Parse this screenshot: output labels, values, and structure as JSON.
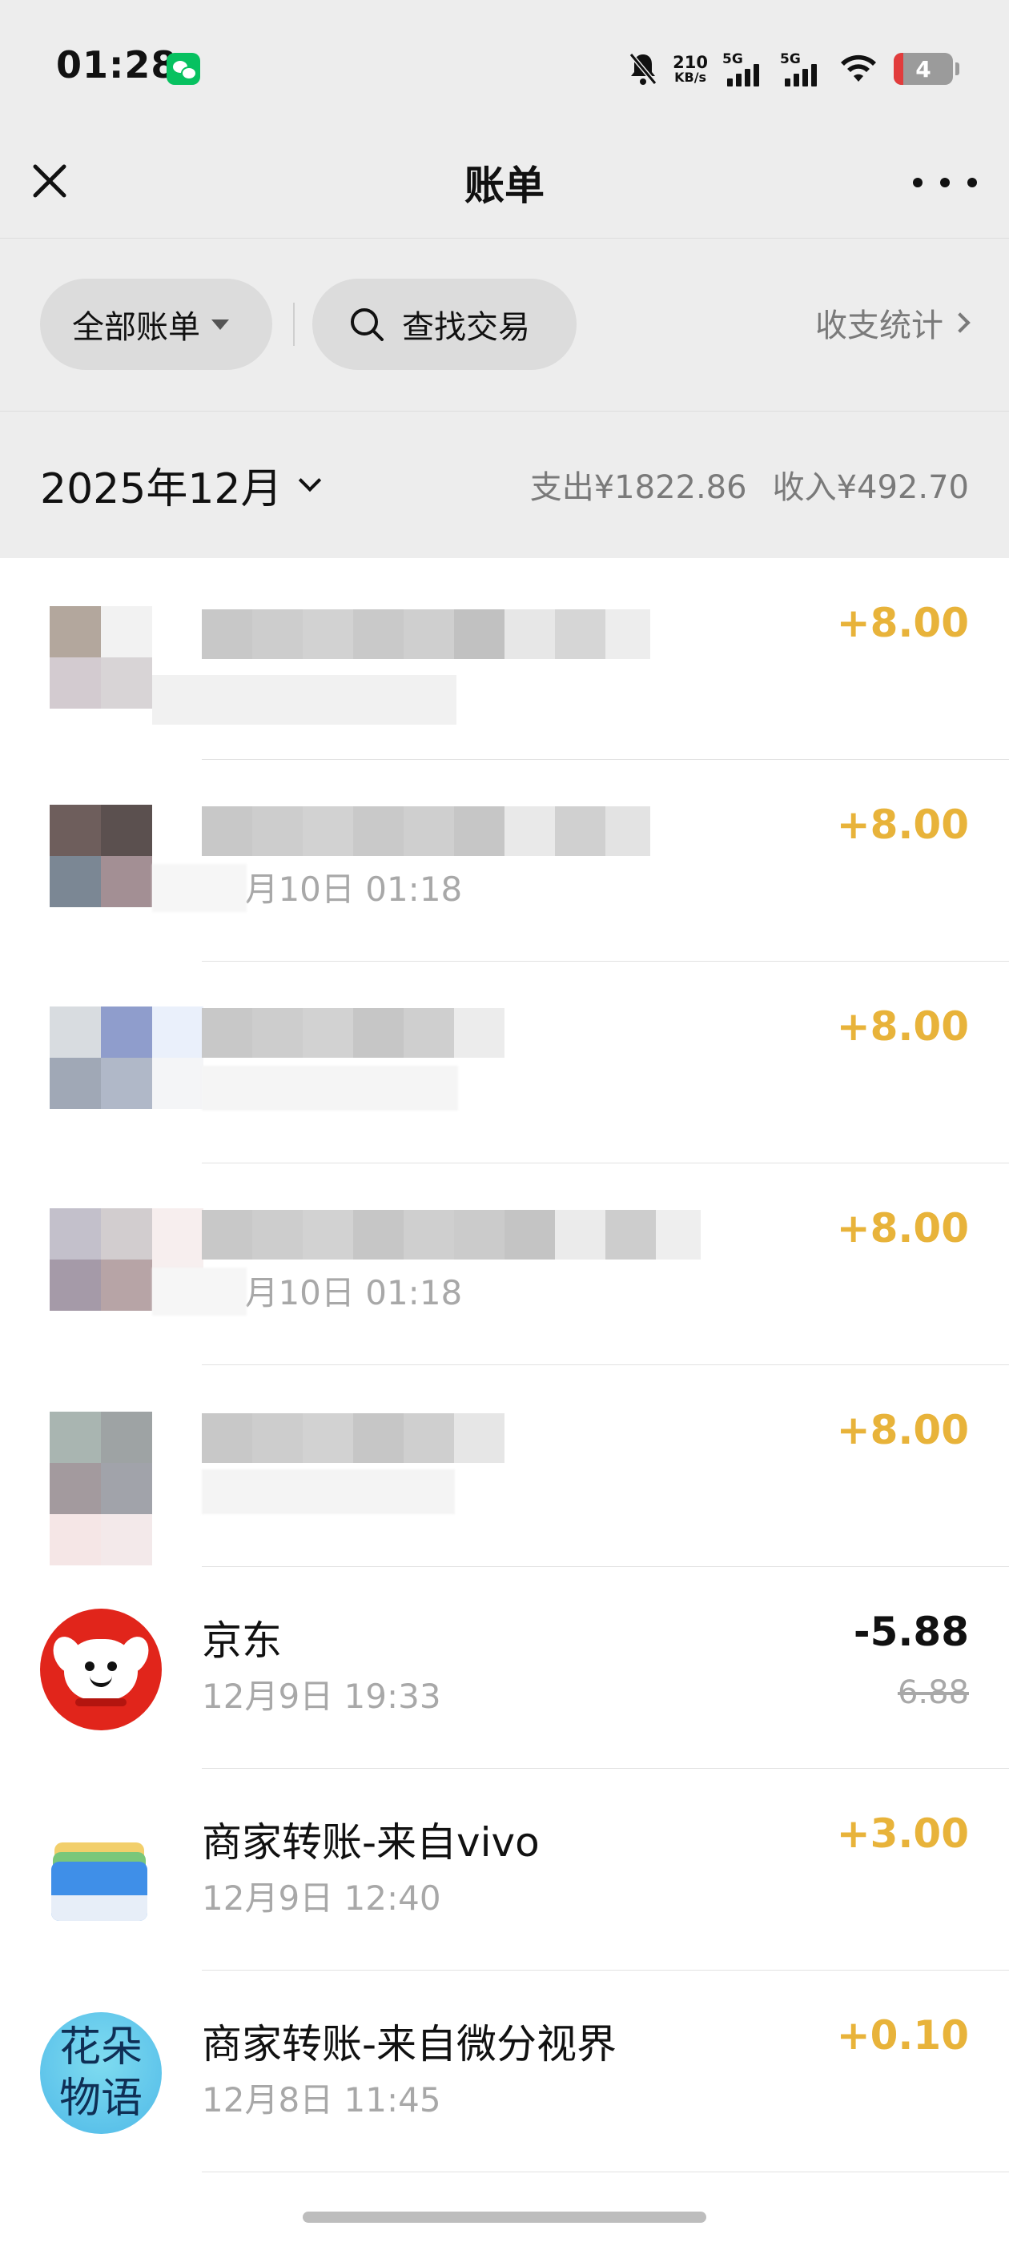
{
  "status_bar": {
    "time": "01:28",
    "speed_value": "210",
    "speed_unit": "KB/s",
    "sim1": "5G",
    "sim2": "5G",
    "battery": "4"
  },
  "nav": {
    "title": "账单"
  },
  "filters": {
    "all_bills": "全部账单",
    "search": "查找交易",
    "stats": "收支统计"
  },
  "month_header": {
    "month": "2025年12月",
    "expense": "支出¥1822.86",
    "income": "收入¥492.70"
  },
  "transactions": [
    {
      "title": "",
      "date": "",
      "amount": "+8.00"
    },
    {
      "title": "",
      "date": "12月10日 01:18",
      "amount": "+8.00"
    },
    {
      "title": "",
      "date": "",
      "amount": "+8.00"
    },
    {
      "title": "",
      "date": "12月10日 01:18",
      "amount": "+8.00"
    },
    {
      "title": "",
      "date": "",
      "amount": "+8.00"
    },
    {
      "title": "京东",
      "date": "12月9日 19:33",
      "amount": "-5.88",
      "original": "6.88"
    },
    {
      "title": "商家转账-来自vivo",
      "date": "12月9日 12:40",
      "amount": "+3.00"
    },
    {
      "title": "商家转账-来自微分视界",
      "date": "12月8日 11:45",
      "amount": "+0.10",
      "avatar_text_1": "花朵",
      "avatar_text_2": "物语"
    }
  ],
  "colors": {
    "income": "#e8b33a",
    "background_gray": "#ededed"
  }
}
